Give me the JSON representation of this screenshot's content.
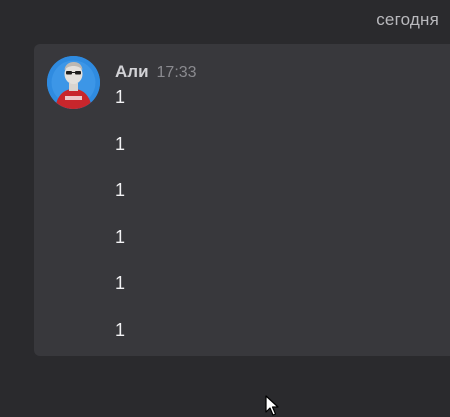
{
  "date_separator": "сегодня",
  "message": {
    "author": "Али",
    "time": "17:33",
    "lines": [
      "1",
      "1",
      "1",
      "1",
      "1",
      "1"
    ]
  },
  "icons": {
    "avatar": "user-avatar-photo",
    "cursor": "mouse-pointer-icon"
  },
  "colors": {
    "background": "#2a2a2d",
    "card": "#38383c",
    "author": "#d2d2d6",
    "timestamp": "#8a8a8f",
    "text": "#f2f2f4"
  }
}
